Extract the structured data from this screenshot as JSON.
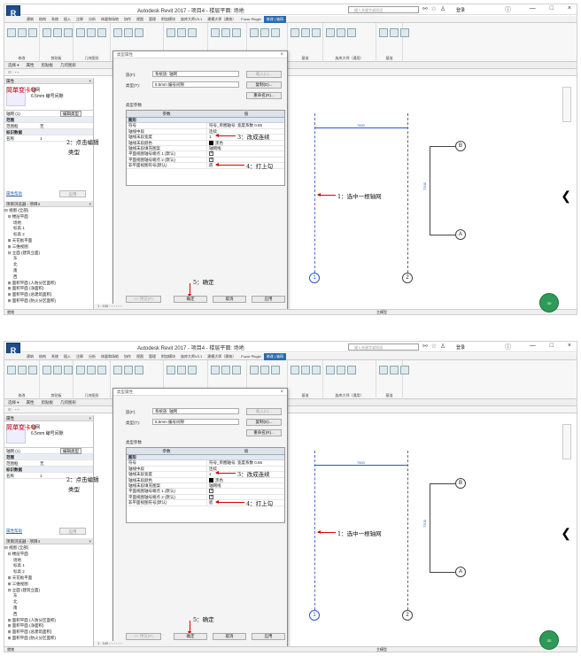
{
  "app": {
    "logo": "R",
    "title": "Autodesk Revit 2017 -   项目4 - 楼层平面: 场地",
    "search_placeholder": "键入关键字或短语",
    "login": "登录",
    "help": "?",
    "window_controls": [
      "—",
      "□",
      "×"
    ]
  },
  "ribbon": {
    "tabs": [
      "建筑",
      "结构",
      "系统",
      "插入",
      "注释",
      "分析",
      "体量和场地",
      "协作",
      "视图",
      "管理",
      "附加模块",
      "族库大师V3.1",
      "建模大师（建筑）",
      "Fuzor Plugin",
      "修改 | 轴网"
    ],
    "active_tab": "修改 | 轴网",
    "group_labels": [
      "修改",
      "剪贴板",
      "几何图形",
      "修改",
      "视图",
      "测量",
      "创建",
      "基准",
      "族库大师（通用）",
      "基准"
    ]
  },
  "selection_bar": [
    "选择 ▾",
    "属性",
    "剪贴板",
    "几何图形"
  ],
  "properties_panel": {
    "header": "属性",
    "handwritten_label": "简单变卡Q",
    "type_name": "轴网",
    "type_sub": "6.5mm 编号间隙",
    "instance_selector": "轴网 (1)",
    "edit_type_button": "编辑类型",
    "rows": [
      {
        "label": "范围",
        "value": ""
      },
      {
        "label": "范围框",
        "value": "无"
      },
      {
        "label": "标识数据",
        "value": ""
      },
      {
        "label": "名称",
        "value": "1"
      }
    ],
    "help_link": "属性帮助",
    "apply_button": "应用"
  },
  "project_browser": {
    "header": "项目浏览器 - 项目4",
    "items": [
      "⊟ 视图 (全部)",
      "   ⊟ 楼层平面",
      "        场地",
      "        标高 1",
      "        标高 2",
      "   ⊞ 天花板平面",
      "   ⊞ 三维视图",
      "   ⊟ 立面 (建筑立面)",
      "        东",
      "        北",
      "        南",
      "        西",
      "   ⊞ 面积平面 (人防分区面积)",
      "   ⊞ 面积平面 (净面积)",
      "   ⊞ 面积平面 (总建筑面积)",
      "   ⊞ 面积平面 (防火分区面积)"
    ]
  },
  "dialog": {
    "title": "类型属性",
    "family_label": "族(F):",
    "family_value": "系统族: 轴网",
    "load_button": "载入(L)...",
    "type_label": "类型(T):",
    "type_value": "6.5mm 编号间隙",
    "duplicate_button": "复制(D)...",
    "rename_button": "重命名(R)...",
    "type_params_label": "类型参数",
    "col_param": "参数",
    "col_value": "值",
    "group_name": "图形",
    "params": [
      {
        "name": "符号",
        "value": "符号_单圈轴号: 宽度系数 0.65"
      },
      {
        "name": "轴线中段",
        "value": "连续"
      },
      {
        "name": "轴线末段宽度",
        "value": "1"
      },
      {
        "name": "轴线末段颜色",
        "value": "黑色"
      },
      {
        "name": "轴线末段填充图案",
        "value": "轴网线"
      },
      {
        "name": "平面视图轴号端点 1 (默认)",
        "value": "checked"
      },
      {
        "name": "平面视图轴号端点 2 (默认)",
        "value": "checked"
      },
      {
        "name": "非平面视图符号(默认)",
        "value": "底"
      }
    ],
    "preview_button": "<< 预览(P)",
    "ok_button": "确定",
    "cancel_button": "取消",
    "apply_button": "应用"
  },
  "annotations": {
    "step1": "1：选中一根轴网",
    "step2": "2：点击编辑",
    "step2_cont": "类型",
    "step3": "3：改成连续",
    "step4": "4：打上勾",
    "step5": "5：确定"
  },
  "canvas": {
    "dim_horizontal": "7600",
    "dim_vertical": "7200",
    "grid_labels": {
      "bottom_left": "1",
      "bottom_right": "2",
      "top_right": "B",
      "mid_right": "A"
    }
  },
  "view_control": "1 : 100",
  "status": {
    "left": "就绪",
    "model": "主模型",
    "nav_label": "3D"
  }
}
